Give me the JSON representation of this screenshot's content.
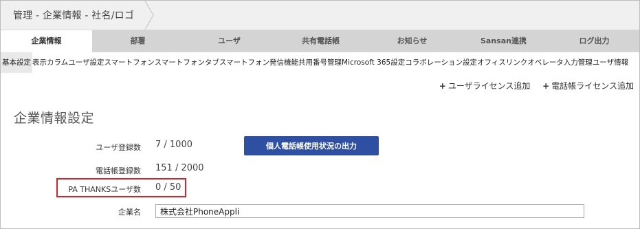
{
  "breadcrumb": "管理 - 企業情報 - 社名/ロゴ",
  "tabs": [
    {
      "label": "企業情報",
      "active": true
    },
    {
      "label": "部署",
      "active": false
    },
    {
      "label": "ユーザ",
      "active": false
    },
    {
      "label": "共有電話帳",
      "active": false
    },
    {
      "label": "お知らせ",
      "active": false
    },
    {
      "label": "Sansan連携",
      "active": false
    },
    {
      "label": "ログ出力",
      "active": false
    }
  ],
  "subnav": [
    {
      "label": "基本設定",
      "active": true
    },
    {
      "label": "表示カラム",
      "active": false
    },
    {
      "label": "ユーザ設定",
      "active": false
    },
    {
      "label": "スマートフォン",
      "active": false
    },
    {
      "label": "スマートフォン",
      "active": false
    },
    {
      "label": "タブ",
      "active": false
    },
    {
      "label": "スマートフォン発信機能",
      "active": false
    },
    {
      "label": "共用番号管理",
      "active": false
    },
    {
      "label": "Microsoft 365設定",
      "active": false
    },
    {
      "label": "コラボレーション設定",
      "active": false
    },
    {
      "label": "オフィスリンク",
      "active": false
    },
    {
      "label": "オペレータ入力管理",
      "active": false
    },
    {
      "label": "ユーザ情報",
      "active": false
    }
  ],
  "actions": {
    "add_user_license": "ユーザライセンス追加",
    "add_phonebook_license": "電話帳ライセンス追加"
  },
  "section_title": "企業情報設定",
  "fields": {
    "user_count_label": "ユーザ登録数",
    "user_count_value": "7 / 1000",
    "export_button": "個人電話帳使用状況の出力",
    "phonebook_count_label": "電話帳登録数",
    "phonebook_count_value": "151 / 2000",
    "pa_thanks_label": "PA THANKSユーザ数",
    "pa_thanks_value": "0 / 50",
    "company_name_label": "企業名",
    "company_name_value": "株式会社PhoneAppli"
  },
  "colors": {
    "primary_button": "#2f4fa2",
    "highlight": "#d4242a",
    "tabbar": "#d4d4d4"
  }
}
